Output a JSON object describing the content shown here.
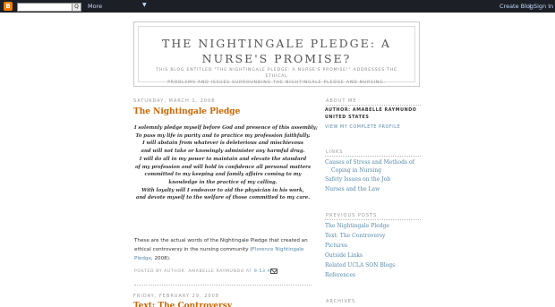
{
  "navbar": {
    "logo": "B",
    "search_button": "Q",
    "more": "More",
    "chevron": "▼",
    "create_blog": "Create Blog",
    "separator": "|",
    "sign_in": "Sign In"
  },
  "header": {
    "title_line1": "THE NIGHTINGALE PLEDGE: A",
    "title_line2": "NURSE'S PROMISE?",
    "description_line1": "THIS BLOG ENTITLED \"THE NIGHTINGALE PLEDGE: A NURSE'S PROMISE!\" ADDRESSES THE ETHICAL",
    "description_line2": "PROBLEMS AND ISSUES SURROUNDING THE NIGHTINGALE PLEDGE AND NURSING."
  },
  "post1": {
    "date": "SATURDAY, MARCH 1, 2008",
    "title": "The Nightingale Pledge",
    "poem": [
      "I solemnly pledge myself before God and presence of this assembly;",
      "To pass my life in purity and to practice my profession faithfully.",
      "I will abstain from whatever is deleterious and mischievous",
      "and will not take or knowingly administer any harmful drug.",
      "I will do all in my power to maintain and elevate the standard",
      "of my profession and will hold in confidence all personal matters",
      "committed to my keeping and family affairs coming to my",
      "knowledge in the practice of my calling.",
      "With loyalty will I endeavor to aid the physician in his work,",
      "and devote myself to the welfare of those committed to my care."
    ],
    "body_line1": "These are the actual words of the Nightingale Pledge that created an",
    "body_line2_text": "ethical controversy in the nursing community (",
    "body_link_part1": "Florence Nightingale",
    "body_link_part2": "Pledge",
    "body_line3_tail": ", 2008).",
    "footer_posted_by": "POSTED BY AUTHOR: AMABELLE RAYMUNDO AT",
    "footer_time": "9:53 AM"
  },
  "post2": {
    "date": "FRIDAY, FEBRUARY 29, 2008",
    "title": "Text: The Controversy"
  },
  "sidebar": {
    "about_heading": "ABOUT ME",
    "author_line": "AUTHOR: AMABELLE RAYMUNDO",
    "country": "UNITED STATES",
    "profile_link": "VIEW MY COMPLETE PROFILE",
    "links_heading": "LINKS",
    "links": [
      "Causes of Stress and Methods of",
      "Coping in Nursing",
      "Safety Issues on the Job",
      "Nurses and the Law"
    ],
    "previous_heading": "PREVIOUS POSTS",
    "previous": [
      "The Nightingale Pledge",
      "Text: The Controversy",
      "Pictures",
      "Outside Links",
      "Related UCLA SON Blogs",
      "References"
    ],
    "archives_heading": "ARCHIVES"
  }
}
